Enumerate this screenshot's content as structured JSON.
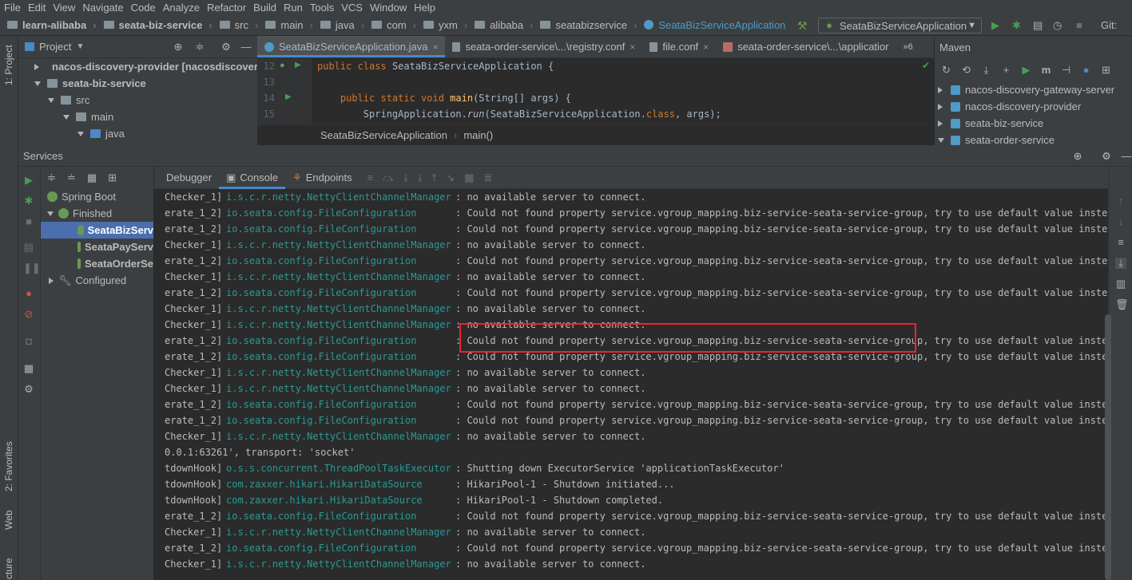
{
  "menu": [
    "File",
    "Edit",
    "View",
    "Navigate",
    "Code",
    "Analyze",
    "Refactor",
    "Build",
    "Run",
    "Tools",
    "VCS",
    "Window",
    "Help"
  ],
  "breadcrumbs": [
    "learn-alibaba",
    "seata-biz-service",
    "src",
    "main",
    "java",
    "com",
    "yxm",
    "alibaba",
    "seatabizservice",
    "SeataBizServiceApplication"
  ],
  "run_config": "SeataBizServiceApplication",
  "git_label": "Git:",
  "left_tool": {
    "project": "1: Project",
    "favorites": "2: Favorites",
    "web": "Web",
    "structure": "cture"
  },
  "project_panel": {
    "title": "Project",
    "tree": [
      {
        "label": "nacos-discovery-provider [nacosdiscover",
        "bold": false
      },
      {
        "label": "seata-biz-service",
        "bold": true
      },
      {
        "label": "src",
        "bold": false
      },
      {
        "label": "main",
        "bold": false
      },
      {
        "label": "java",
        "bold": false
      }
    ]
  },
  "editor": {
    "tabs": [
      {
        "label": "SeataBizServiceApplication.java",
        "active": true
      },
      {
        "label": "seata-order-service\\...\\registry.conf",
        "active": false
      },
      {
        "label": "file.conf",
        "active": false
      },
      {
        "label": "seata-order-service\\...\\applicatior",
        "active": false
      }
    ],
    "tab_overflow": "»6",
    "lines": [
      {
        "num": "12",
        "tokens": [
          [
            "kw",
            "public "
          ],
          [
            "kw",
            "class "
          ],
          [
            "cls",
            "SeataBizServiceApplication "
          ],
          [
            "pl",
            "{"
          ]
        ]
      },
      {
        "num": "13",
        "tokens": []
      },
      {
        "num": "14",
        "tokens": [
          [
            "kw",
            "    public static void "
          ],
          [
            "fn",
            "main"
          ],
          [
            "pl",
            "(String[] args) {"
          ]
        ]
      },
      {
        "num": "15",
        "tokens": [
          [
            "pl",
            "        SpringApplication."
          ],
          [
            "it",
            "run"
          ],
          [
            "pl",
            "(SeataBizServiceApplication."
          ],
          [
            "kw",
            "class"
          ],
          [
            "pl",
            ", args);"
          ]
        ]
      }
    ],
    "breadcrumb": [
      "SeataBizServiceApplication",
      "main()"
    ]
  },
  "maven": {
    "title": "Maven",
    "items": [
      "nacos-discovery-gateway-server",
      "nacos-discovery-provider",
      "seata-biz-service",
      "seata-order-service"
    ]
  },
  "services": {
    "title": "Services",
    "tree": [
      {
        "label": "Spring Boot",
        "selected": false
      },
      {
        "label": "Finished",
        "selected": false
      },
      {
        "label": "SeataBizServ",
        "selected": true
      },
      {
        "label": "SeataPayServ",
        "selected": false
      },
      {
        "label": "SeataOrderSe",
        "selected": false
      },
      {
        "label": "Configured",
        "selected": false
      }
    ],
    "console_tabs": [
      "Debugger",
      "Console",
      "Endpoints"
    ],
    "log": [
      {
        "t": "Checker_1]",
        "l": "i.s.c.r.netty.NettyClientChannelManager",
        "m": ": no available server to connect."
      },
      {
        "t": "erate_1_2]",
        "l": "io.seata.config.FileConfiguration",
        "m": ": Could not found property service.vgroup_mapping.biz-service-seata-service-group, try to use default value instead."
      },
      {
        "t": "erate_1_2]",
        "l": "io.seata.config.FileConfiguration",
        "m": ": Could not found property service.vgroup_mapping.biz-service-seata-service-group, try to use default value instead."
      },
      {
        "t": "Checker_1]",
        "l": "i.s.c.r.netty.NettyClientChannelManager",
        "m": ": no available server to connect."
      },
      {
        "t": "erate_1_2]",
        "l": "io.seata.config.FileConfiguration",
        "m": ": Could not found property service.vgroup_mapping.biz-service-seata-service-group, try to use default value instead."
      },
      {
        "t": "Checker_1]",
        "l": "i.s.c.r.netty.NettyClientChannelManager",
        "m": ": no available server to connect."
      },
      {
        "t": "erate_1_2]",
        "l": "io.seata.config.FileConfiguration",
        "m": ": Could not found property service.vgroup_mapping.biz-service-seata-service-group, try to use default value instead."
      },
      {
        "t": "Checker_1]",
        "l": "i.s.c.r.netty.NettyClientChannelManager",
        "m": ": no available server to connect."
      },
      {
        "t": "Checker_1]",
        "l": "i.s.c.r.netty.NettyClientChannelManager",
        "m": ": no available server to connect."
      },
      {
        "t": "erate_1_2]",
        "l": "io.seata.config.FileConfiguration",
        "m": ": Could not found property service.vgroup_mapping.biz-service-seata-service-group, try to use default value instead."
      },
      {
        "t": "erate_1_2]",
        "l": "io.seata.config.FileConfiguration",
        "m": ": Could not found property service.vgroup_mapping.biz-service-seata-service-group, try to use default value instead."
      },
      {
        "t": "Checker_1]",
        "l": "i.s.c.r.netty.NettyClientChannelManager",
        "m": ": no available server to connect."
      },
      {
        "t": "Checker_1]",
        "l": "i.s.c.r.netty.NettyClientChannelManager",
        "m": ": no available server to connect."
      },
      {
        "t": "erate_1_2]",
        "l": "io.seata.config.FileConfiguration",
        "m": ": Could not found property service.vgroup_mapping.biz-service-seata-service-group, try to use default value instead."
      },
      {
        "t": "erate_1_2]",
        "l": "io.seata.config.FileConfiguration",
        "m": ": Could not found property service.vgroup_mapping.biz-service-seata-service-group, try to use default value instead."
      },
      {
        "t": "Checker_1]",
        "l": "i.s.c.r.netty.NettyClientChannelManager",
        "m": ": no available server to connect."
      },
      {
        "t": "0.0.1:63261', transport: 'socket'",
        "l": "",
        "m": ""
      },
      {
        "t": "tdownHook]",
        "l": "o.s.s.concurrent.ThreadPoolTaskExecutor",
        "m": ": Shutting down ExecutorService 'applicationTaskExecutor'"
      },
      {
        "t": "tdownHook]",
        "l": "com.zaxxer.hikari.HikariDataSource",
        "m": ": HikariPool-1 - Shutdown initiated..."
      },
      {
        "t": "tdownHook]",
        "l": "com.zaxxer.hikari.HikariDataSource",
        "m": ": HikariPool-1 - Shutdown completed."
      },
      {
        "t": "erate_1_2]",
        "l": "io.seata.config.FileConfiguration",
        "m": ": Could not found property service.vgroup_mapping.biz-service-seata-service-group, try to use default value instead."
      },
      {
        "t": "Checker_1]",
        "l": "i.s.c.r.netty.NettyClientChannelManager",
        "m": ": no available server to connect."
      },
      {
        "t": "erate_1_2]",
        "l": "io.seata.config.FileConfiguration",
        "m": ": Could not found property service.vgroup_mapping.biz-service-seata-service-group, try to use default value instead."
      },
      {
        "t": "Checker_1]",
        "l": "i.s.c.r.netty.NettyClientChannelManager",
        "m": ": no available server to connect."
      }
    ]
  },
  "colors": {
    "logger": "#299999",
    "highlight_box": "#e8262b",
    "selection": "#4b6eaf",
    "run_green": "#499c54"
  }
}
